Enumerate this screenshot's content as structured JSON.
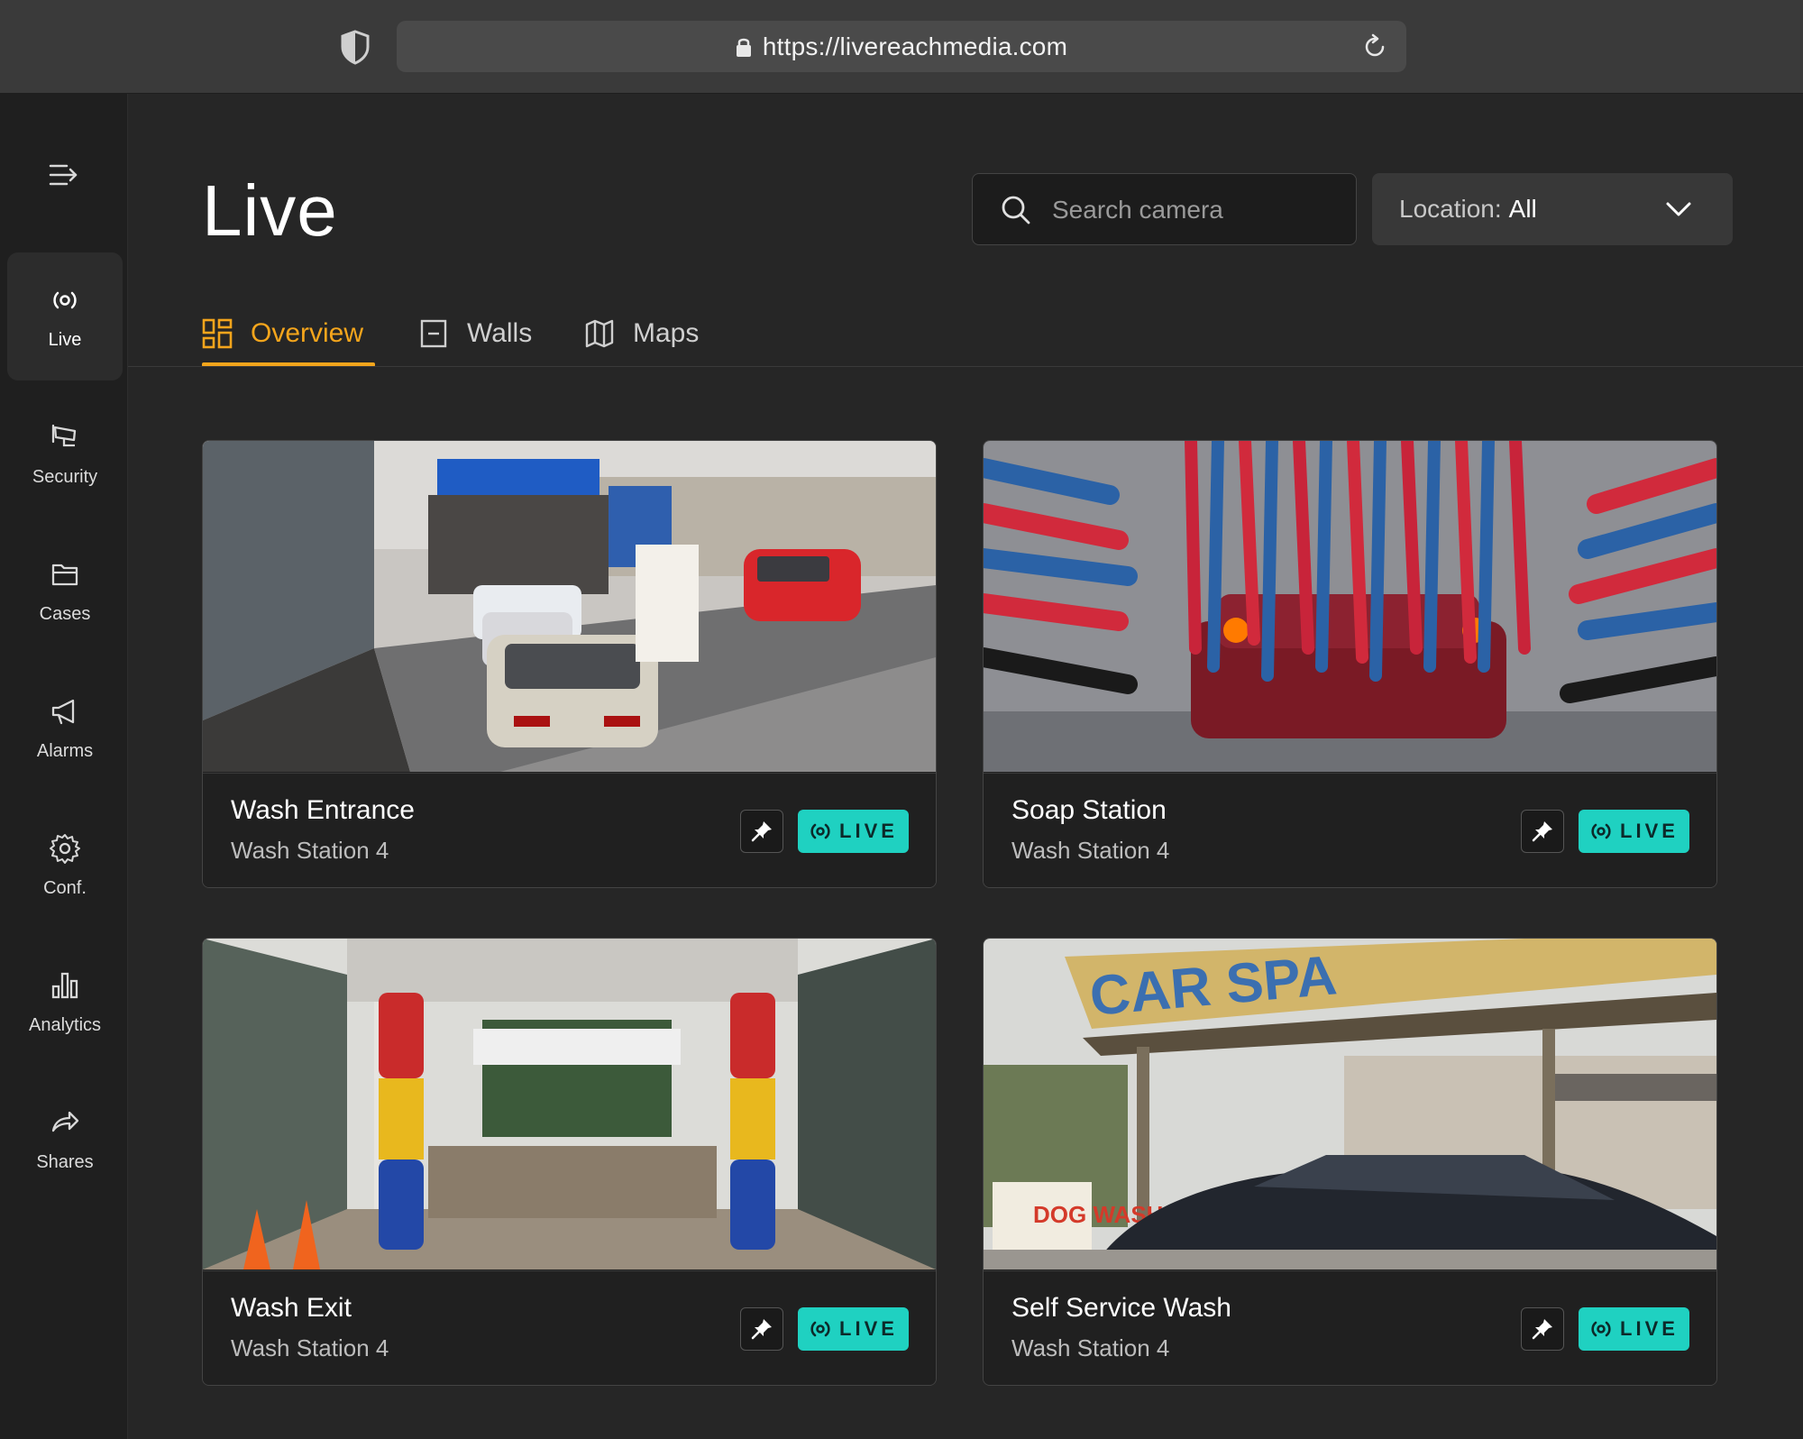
{
  "browser": {
    "url": "https://livereachmedia.com"
  },
  "sidebar": {
    "items": [
      {
        "label": "Live",
        "icon": "live-broadcast-icon",
        "active": true
      },
      {
        "label": "Security",
        "icon": "security-camera-icon",
        "active": false
      },
      {
        "label": "Cases",
        "icon": "folder-icon",
        "active": false
      },
      {
        "label": "Alarms",
        "icon": "megaphone-icon",
        "active": false
      },
      {
        "label": "Conf.",
        "icon": "gear-icon",
        "active": false
      },
      {
        "label": "Analytics",
        "icon": "bar-chart-icon",
        "active": false
      },
      {
        "label": "Shares",
        "icon": "share-arrow-icon",
        "active": false
      }
    ]
  },
  "header": {
    "title": "Live",
    "search_placeholder": "Search camera",
    "location_prefix": "Location:",
    "location_value": "All"
  },
  "tabs": [
    {
      "label": "Overview",
      "icon": "grid-icon",
      "active": true
    },
    {
      "label": "Walls",
      "icon": "wall-panel-icon",
      "active": false
    },
    {
      "label": "Maps",
      "icon": "map-icon",
      "active": false
    }
  ],
  "cameras": [
    {
      "name": "Wash Entrance",
      "location": "Wash Station 4",
      "status": "LIVE"
    },
    {
      "name": "Soap Station",
      "location": "Wash Station 4",
      "status": "LIVE"
    },
    {
      "name": "Wash Exit",
      "location": "Wash Station 4",
      "status": "LIVE"
    },
    {
      "name": "Self Service Wash",
      "location": "Wash Station 4",
      "status": "LIVE"
    }
  ],
  "thumbnail_text": {
    "car_spa_sign": "CAR SPA",
    "dog_wash_sign": "DOG WASH"
  },
  "colors": {
    "accent": "#f4a51c",
    "live_badge": "#1fd1c1",
    "background": "#262626",
    "sidebar": "#1f1f1f"
  }
}
